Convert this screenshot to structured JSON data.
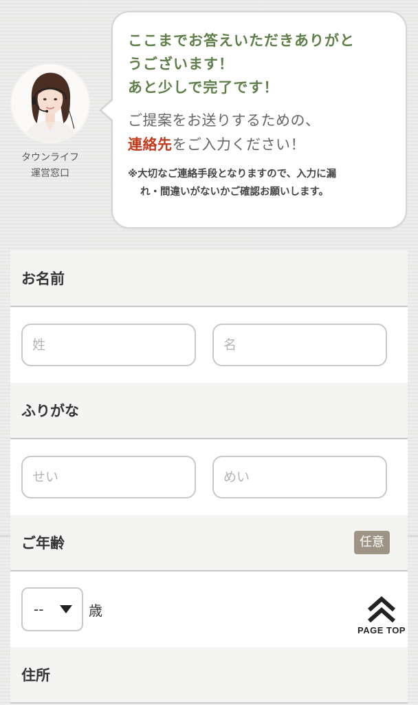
{
  "operator": {
    "caption_line1": "タウンライフ",
    "caption_line2": "運営窓口"
  },
  "bubble": {
    "greeting_line1": "ここまでお答えいただきありがと",
    "greeting_line2": "うございます！",
    "greeting_line3": "あと少しで完了です！",
    "proposal_line1": "ご提案をお送りするための、",
    "proposal_highlight": "連絡先",
    "proposal_rest": "をご入力ください！",
    "note_line1": "※大切なご連絡手段となりますので、入力に漏",
    "note_line2": "れ・間違いがないかご確認お願いします。"
  },
  "form": {
    "name": {
      "label": "お名前",
      "last_placeholder": "姓",
      "first_placeholder": "名"
    },
    "furigana": {
      "label": "ふりがな",
      "last_placeholder": "せい",
      "first_placeholder": "めい"
    },
    "age": {
      "label": "ご年齢",
      "badge": "任意",
      "selected": "--",
      "unit": "歳"
    },
    "address": {
      "label": "住所"
    }
  },
  "page_top": {
    "label": "PAGE TOP"
  },
  "colors": {
    "greeting": "#5f7f4a",
    "highlight": "#c23b1e",
    "badge": "#9d9486"
  }
}
